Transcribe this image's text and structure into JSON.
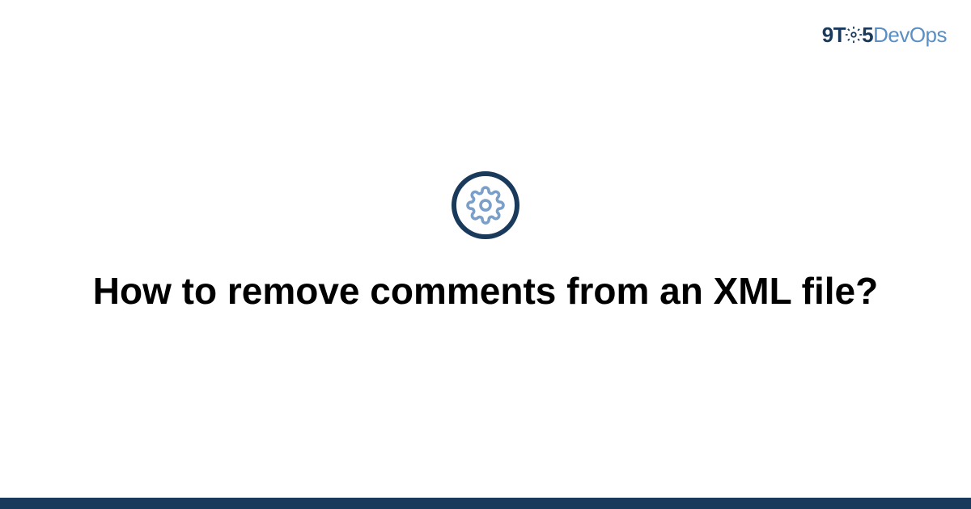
{
  "logo": {
    "part1": "9T",
    "part2": "5",
    "part3": "DevOps"
  },
  "icon": {
    "name": "gear-icon"
  },
  "title": "How to remove comments from an XML file?",
  "colors": {
    "dark_navy": "#1a3a5c",
    "light_blue": "#5a8fc4",
    "gear_blue": "#7a9fc9"
  }
}
